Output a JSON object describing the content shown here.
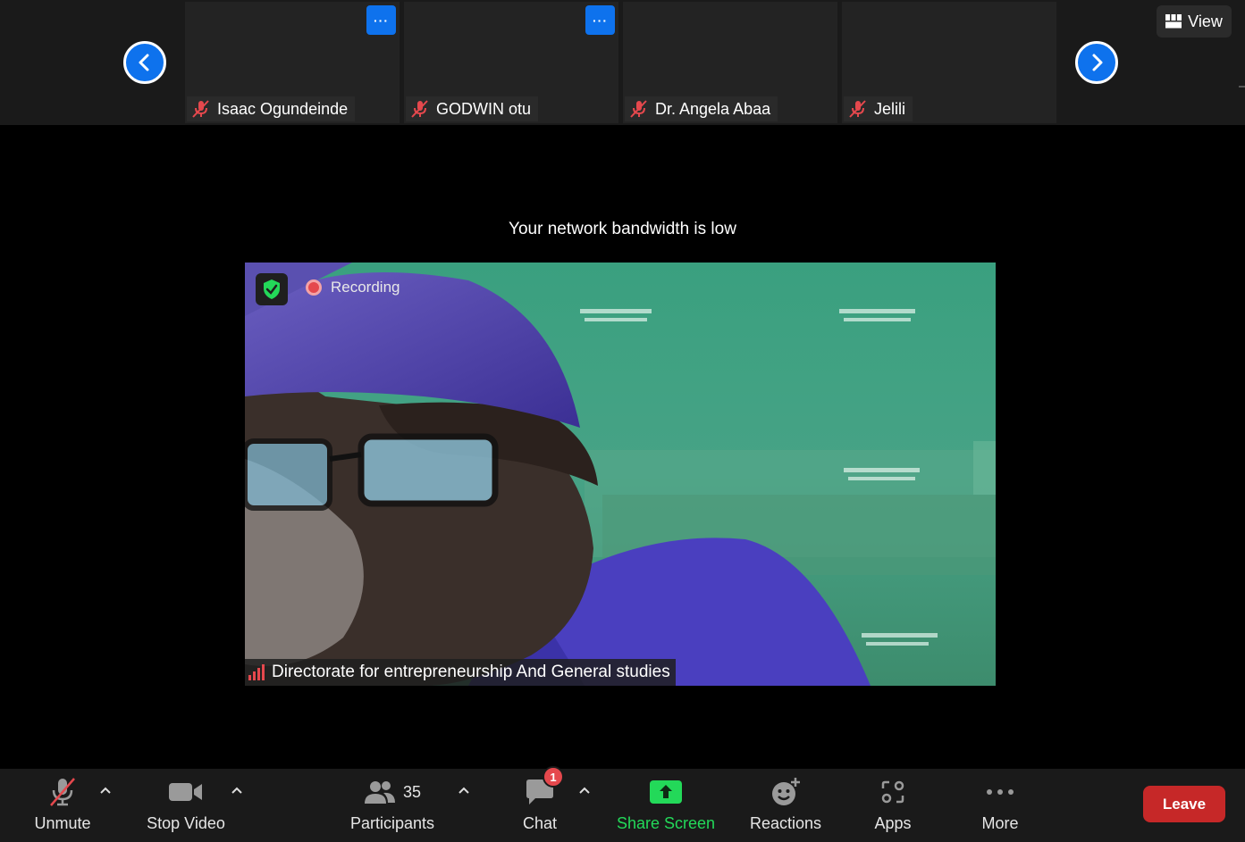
{
  "participants_strip": {
    "tiles": [
      {
        "name": "Isaac Ogundeinde",
        "has_more": true
      },
      {
        "name": "GODWIN otu",
        "has_more": true
      },
      {
        "name": "Dr. Angela Abaa",
        "has_more": false
      },
      {
        "name": "Jelili",
        "has_more": false
      }
    ],
    "more_label": "···",
    "view_label": "View"
  },
  "notice": "Your network bandwidth is low",
  "video": {
    "recording_label": "Recording",
    "speaker_name": "Directorate for entrepreneurship And General studies"
  },
  "toolbar": {
    "unmute": "Unmute",
    "stop_video": "Stop Video",
    "participants": "Participants",
    "participants_count": "35",
    "chat": "Chat",
    "chat_badge": "1",
    "share_screen": "Share Screen",
    "reactions": "Reactions",
    "apps": "Apps",
    "more": "More",
    "leave": "Leave"
  },
  "colors": {
    "accent_blue": "#0e72ed",
    "share_green": "#23d959",
    "leave_red": "#c62828",
    "muted_red": "#e5484d"
  }
}
